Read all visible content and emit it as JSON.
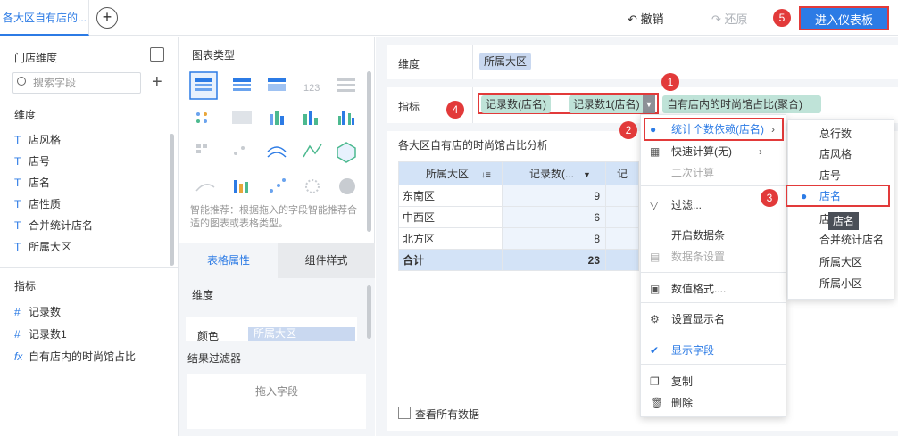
{
  "topbar": {
    "tab_title": "各大区自有店的...",
    "undo_label": "撤销",
    "redo_label": "还原",
    "enter_dashboard_label": "进入仪表板"
  },
  "left_panel": {
    "store_dimension_title": "门店维度",
    "search_placeholder": "搜索字段",
    "dimension_section": "维度",
    "dimension_fields": [
      "店风格",
      "店号",
      "店名",
      "店性质",
      "合并统计店名",
      "所属大区"
    ],
    "metric_section": "指标",
    "metric_fields": [
      {
        "icon": "#",
        "label": "记录数"
      },
      {
        "icon": "#",
        "label": "记录数1"
      },
      {
        "icon": "fx",
        "label": "自有店内的时尚馆占比"
      }
    ]
  },
  "chart_type_panel": {
    "title": "图表类型",
    "smart_hint": "智能推荐：根据拖入的字段智能推荐合适的图表或表格类型。",
    "tab_table_attr": "表格属性",
    "tab_component_style": "组件样式",
    "dimension_label": "维度",
    "color_label": "颜色",
    "color_value": "所属大区",
    "result_filter_label": "结果过滤器",
    "drop_field_hint": "拖入字段"
  },
  "editor": {
    "dimension_label": "维度",
    "dimension_pill": "所属大区",
    "metric_label": "指标",
    "metric_pills": [
      "记录数(店名)",
      "记录数1(店名)",
      "自有店内的时尚馆占比(聚合)"
    ],
    "chart_title": "各大区自有店的时尚馆占比分析",
    "show_all_data": "查看所有数据"
  },
  "table": {
    "headers": [
      "所属大区",
      "记录数(...",
      "记"
    ],
    "rows": [
      {
        "region": "东南区",
        "count": "9"
      },
      {
        "region": "中西区",
        "count": "6"
      },
      {
        "region": "北方区",
        "count": "8"
      }
    ],
    "total_label": "合计",
    "total_value": "23"
  },
  "context_menu": {
    "items": [
      {
        "label": "统计个数依赖(店名)",
        "icon": "bullet"
      },
      {
        "label": "快速计算(无)",
        "icon": "calc-icon"
      },
      {
        "label": "二次计算",
        "icon": ""
      },
      {
        "label": "过滤...",
        "icon": "filter-icon"
      },
      {
        "label": "开启数据条",
        "icon": ""
      },
      {
        "label": "数据条设置",
        "icon": "databar-icon"
      },
      {
        "label": "数值格式....",
        "icon": "number-format-icon"
      },
      {
        "label": "设置显示名",
        "icon": "gear-icon"
      },
      {
        "label": "显示字段",
        "icon": "check-icon"
      },
      {
        "label": "复制",
        "icon": "copy-icon"
      },
      {
        "label": "删除",
        "icon": "trash-icon"
      }
    ]
  },
  "submenu": {
    "items": [
      "总行数",
      "店风格",
      "店号",
      "店名",
      "店",
      "合并统计店名",
      "所属大区",
      "所属小区"
    ],
    "selected": "店名",
    "tooltip": "店名"
  },
  "badges": [
    "1",
    "2",
    "3",
    "4",
    "5"
  ],
  "colors": {
    "accent": "#2c7be5",
    "badge_red": "#e23a3a",
    "pill_blue": "#c9d8f0",
    "pill_green": "#bfe3d8"
  }
}
